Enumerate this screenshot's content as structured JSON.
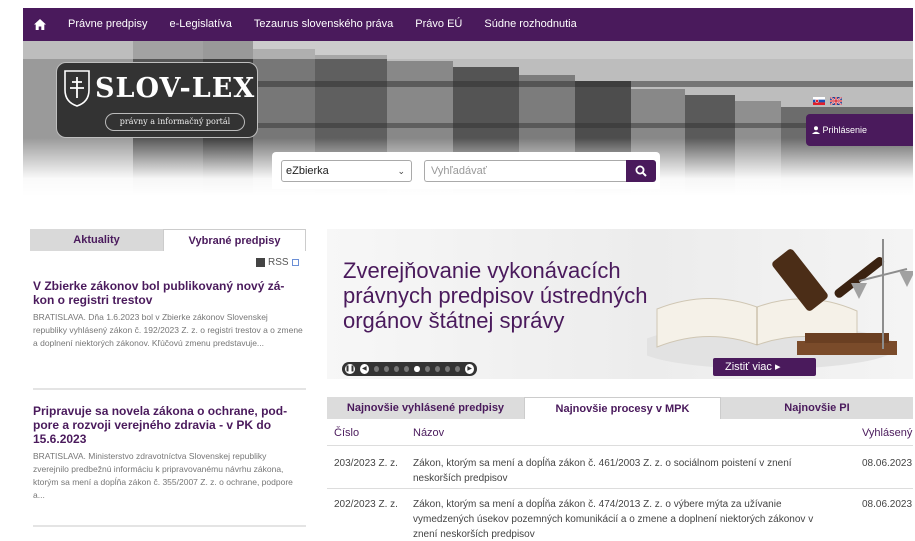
{
  "nav": {
    "items": [
      "Právne predpisy",
      "e-Legislatíva",
      "Tezaurus slovenského práva",
      "Právo EÚ",
      "Súdne rozhodnutia"
    ]
  },
  "logo": {
    "title": "SLOV-LEX",
    "subtitle": "právny a informačný portál"
  },
  "header": {
    "login_label": "Prihlásenie"
  },
  "search": {
    "select_value": "eZbierka",
    "placeholder": "Vyhľadávať"
  },
  "left": {
    "tabs": [
      "Aktuality",
      "Vybrané predpisy"
    ],
    "rss_label": "RSS",
    "news": [
      {
        "title": "V Zbierke zákonov bol publikovaný nový zá-kon o registri trestov",
        "text": "BRATISLAVA. Dňa 1.6.2023 bol v Zbierke zákonov Slovenskej republiky vyhlásený zákon č. 192/2023 Z. z. o registri trestov a o zmene a doplnení niektorých zákonov. Kľúčovú zmenu predstavuje..."
      },
      {
        "title": "Pripravuje sa novela zákona o ochrane, pod-pore a rozvoji verejného zdravia - v PK do 15.6.2023",
        "text": "BRATISLAVA. Ministerstvo zdravotníctva Slovenskej republiky zverejnilo predbežnú informáciu k pripravovanému návrhu zákona, ktorým sa mení a dopĺňa zákon č. 355/2007 Z. z. o ochrane, podpore a..."
      }
    ]
  },
  "slider": {
    "text": "Zverejňovanie vykonávacích právnych predpisov ústredných orgánov štátnej správy",
    "more_label": "Zistiť viac ▸",
    "active_slide": 5,
    "slide_count": 9
  },
  "table": {
    "tabs": [
      "Najnovšie vyhlásené predpisy",
      "Najnovšie procesy v MPK",
      "Najnovšie PI"
    ],
    "headers": [
      "Číslo",
      "Názov",
      "Vyhlásený"
    ],
    "rows": [
      {
        "number": "203/2023 Z. z.",
        "name": "Zákon, ktorým sa mení a dopĺňa zákon č. 461/2003 Z. z. o sociálnom poistení v znení neskorších predpisov",
        "date": "08.06.2023"
      },
      {
        "number": "202/2023 Z. z.",
        "name": "Zákon, ktorým sa mení a dopĺňa zákon č. 474/2013 Z. z. o výbere mýta za užívanie vymedzených úsekov pozemných komunikácií a o zmene a doplnení niektorých zákonov v znení neskorších predpisov",
        "date": "08.06.2023"
      }
    ]
  },
  "colors": {
    "brand": "#4a1a5c",
    "text": "#444444",
    "muted": "#777777"
  }
}
